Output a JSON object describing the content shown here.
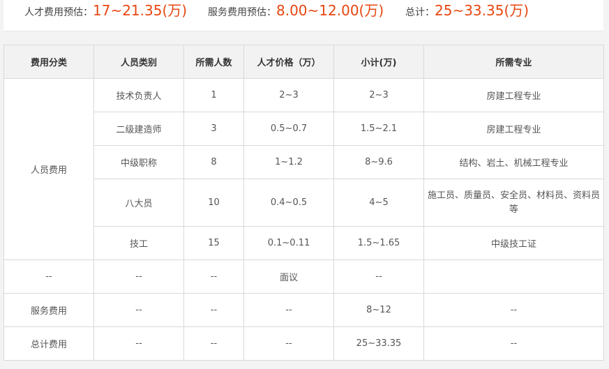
{
  "summary": {
    "talent": {
      "label": "人才费用预估：",
      "value": "17~21.35(万)"
    },
    "service": {
      "label": "服务费用预估：",
      "value": "8.00~12.00(万)"
    },
    "total": {
      "label": "总计：",
      "value": "25~33.35(万)"
    }
  },
  "table": {
    "headers": [
      "费用分类",
      "人员类别",
      "所需人数",
      "人才价格（万）",
      "小计(万)",
      "所需专业"
    ],
    "group_label": "人员费用",
    "personnel_rows": [
      {
        "category": "技术负责人",
        "count": "1",
        "price": "2~3",
        "subtotal": "2~3",
        "major": "房建工程专业"
      },
      {
        "category": "二级建造师",
        "count": "3",
        "price": "0.5~0.7",
        "subtotal": "1.5~2.1",
        "major": "房建工程专业"
      },
      {
        "category": "中级职称",
        "count": "8",
        "price": "1~1.2",
        "subtotal": "8~9.6",
        "major": "结构、岩土、机械工程专业"
      },
      {
        "category": "八大员",
        "count": "10",
        "price": "0.4~0.5",
        "subtotal": "4~5",
        "major": "施工员、质量员、安全员、材料员、资料员等"
      },
      {
        "category": "技工",
        "count": "15",
        "price": "0.1~0.11",
        "subtotal": "1.5~1.65",
        "major": "中级技工证"
      }
    ],
    "other_rows": [
      {
        "type": "--",
        "category": "--",
        "count": "--",
        "price": "面议",
        "subtotal": "--",
        "major": ""
      },
      {
        "type": "服务费用",
        "category": "--",
        "count": "--",
        "price": "--",
        "subtotal": "8~12",
        "major": "--"
      },
      {
        "type": "总计费用",
        "category": "--",
        "count": "--",
        "price": "--",
        "subtotal": "25~33.35",
        "major": "--"
      }
    ]
  },
  "colors": {
    "accent": "#e8450f",
    "link": "#2aa0dc",
    "header_bg": "#f2f2f2"
  }
}
